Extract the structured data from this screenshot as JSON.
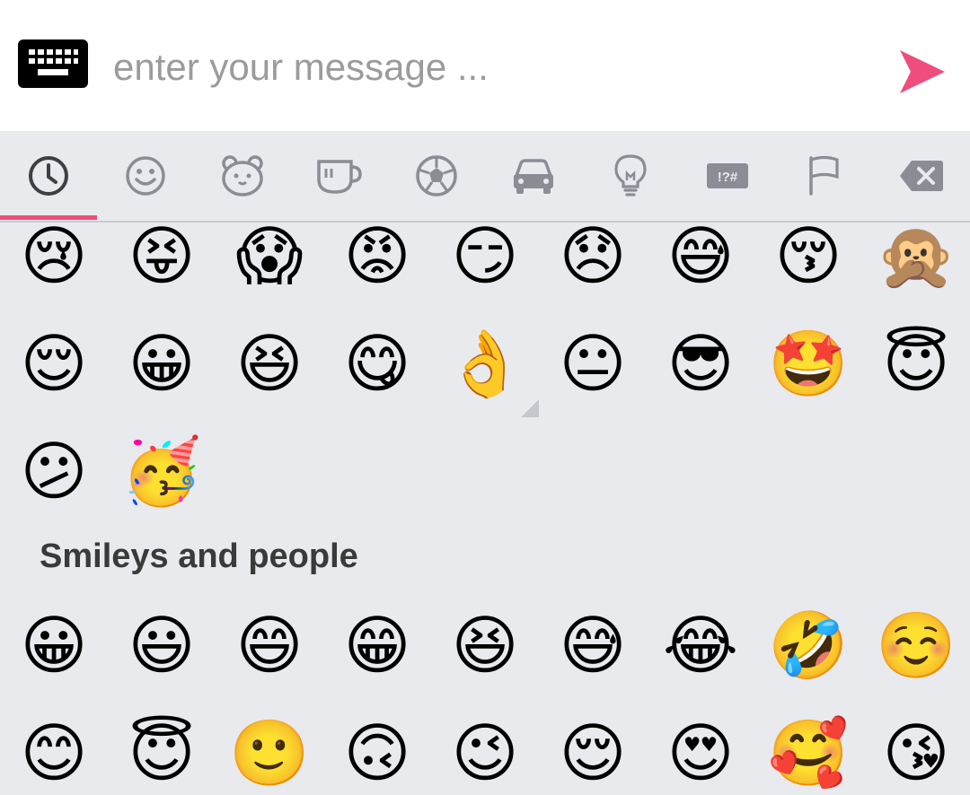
{
  "input": {
    "placeholder": "enter your message ..."
  },
  "colors": {
    "accent": "#ef4d7e",
    "icon": "#8a8e94",
    "active_icon": "#3d3f44",
    "background": "#e8eaee"
  },
  "tabs": [
    {
      "name": "recent",
      "icon": "clock-icon",
      "active": true
    },
    {
      "name": "smileys",
      "icon": "smiley-icon"
    },
    {
      "name": "animals",
      "icon": "bear-icon"
    },
    {
      "name": "food",
      "icon": "cup-icon"
    },
    {
      "name": "activity",
      "icon": "soccer-ball-icon"
    },
    {
      "name": "travel",
      "icon": "car-icon"
    },
    {
      "name": "objects",
      "icon": "lightbulb-icon"
    },
    {
      "name": "symbols",
      "icon": "symbols-icon",
      "label": "!?#"
    },
    {
      "name": "flags",
      "icon": "flag-icon"
    },
    {
      "name": "delete",
      "icon": "backspace-icon"
    }
  ],
  "recent_emojis": [
    "😢",
    "😝",
    "😱",
    "😡",
    "😏",
    "😞",
    "😅",
    "😚",
    "🙊",
    "😌",
    "😀",
    "😆",
    "😋",
    "👌",
    "😐",
    "😎",
    "🤩",
    "😇",
    "😕",
    "🥳"
  ],
  "section": {
    "title": "Smileys and people"
  },
  "smileys_emojis": [
    "😀",
    "😃",
    "😄",
    "😁",
    "😆",
    "😅",
    "😂",
    "🤣",
    "☺️",
    "😊",
    "😇",
    "🙂",
    "🙃",
    "😉",
    "😌",
    "😍",
    "🥰",
    "😘"
  ]
}
